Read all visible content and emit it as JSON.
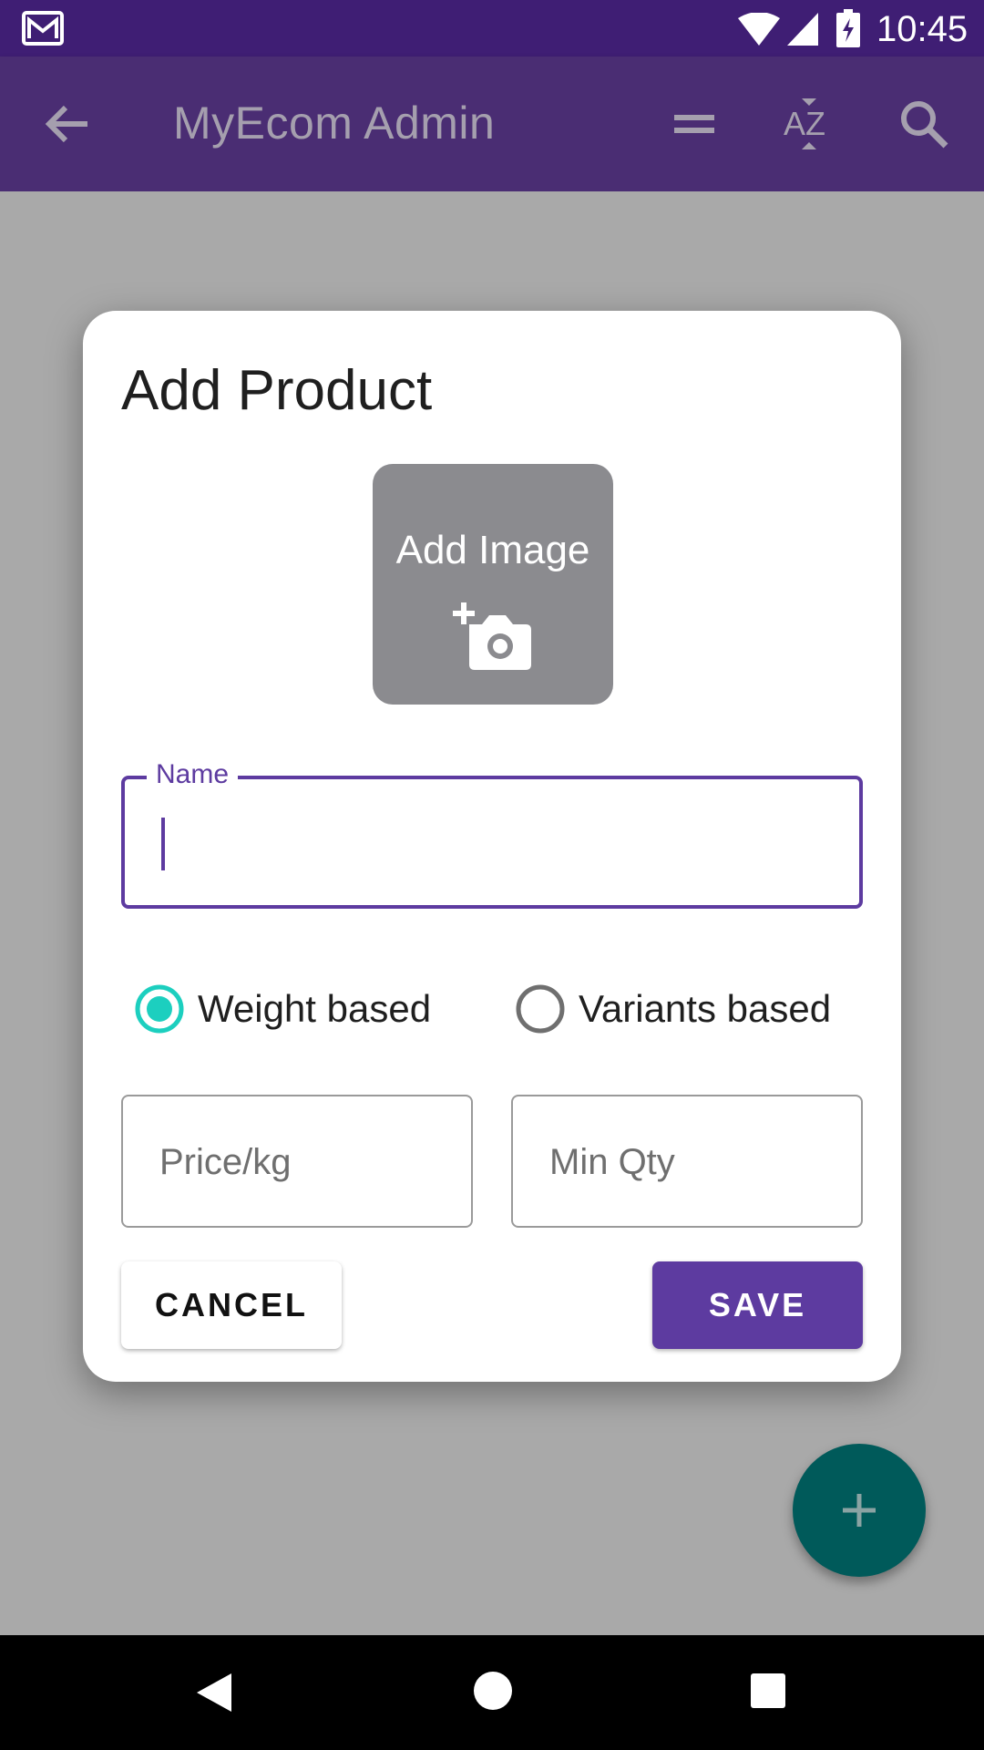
{
  "status_bar": {
    "time": "10:45",
    "icons": [
      "gmail-icon",
      "wifi-icon",
      "signal-icon",
      "battery-icon"
    ]
  },
  "app_bar": {
    "title": "MyEcom Admin",
    "icons": [
      "back-arrow-icon",
      "menu-lines-icon",
      "sort-az-icon",
      "search-icon"
    ]
  },
  "dialog": {
    "title": "Add Product",
    "add_image_label": "Add Image",
    "name_field": {
      "label": "Name",
      "value": ""
    },
    "radios": [
      {
        "label": "Weight based",
        "selected": true
      },
      {
        "label": "Variants based",
        "selected": false
      }
    ],
    "price_field": {
      "placeholder": "Price/kg",
      "value": ""
    },
    "min_qty_field": {
      "placeholder": "Min Qty",
      "value": ""
    },
    "cancel_label": "CANCEL",
    "save_label": "SAVE"
  },
  "fab": {
    "icon": "plus-icon"
  },
  "nav_bar": {
    "icons": [
      "back-triangle-icon",
      "home-circle-icon",
      "recents-square-icon"
    ]
  },
  "colors": {
    "status_bar": "#3f1e74",
    "app_bar": "#4a2d73",
    "scrim": "#a9a9a9",
    "primary": "#5d3ba0",
    "radio_accent": "#1ccfbf",
    "fab": "#005a5a"
  }
}
